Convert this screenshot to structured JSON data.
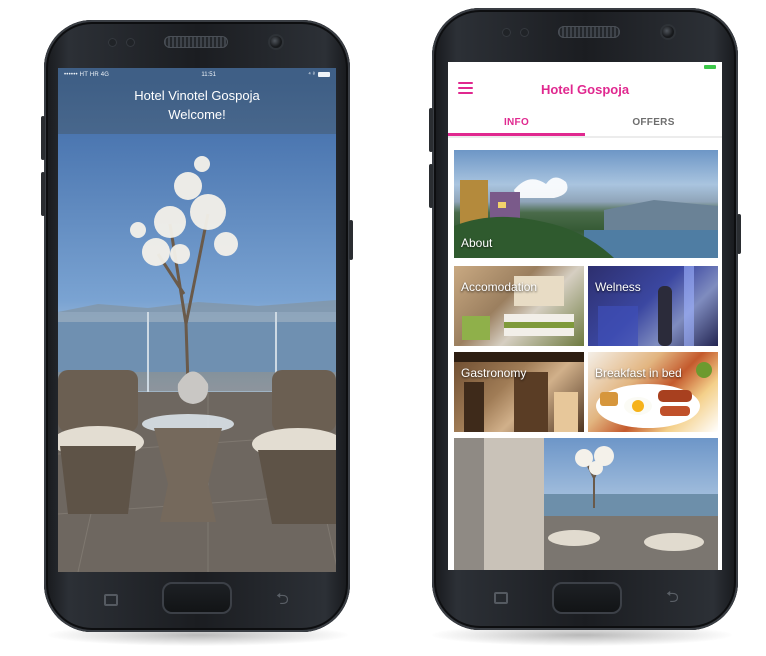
{
  "left_phone": {
    "status_bar": {
      "carrier": "•••••• HT HR  4G",
      "time": "11:51",
      "indicators": "⁴ ⁸"
    },
    "header": {
      "title": "Hotel Vinotel Gospoja",
      "subtitle": "Welcome!"
    },
    "icons": [
      "recent-apps-icon",
      "back-icon"
    ]
  },
  "right_phone": {
    "app_bar": {
      "title": "Hotel Gospoja"
    },
    "tabs": [
      {
        "label": "INFO",
        "active": true
      },
      {
        "label": "OFFERS",
        "active": false
      }
    ],
    "tiles": [
      {
        "label": "About"
      },
      {
        "label": "Accomodation"
      },
      {
        "label": "Welness"
      },
      {
        "label": "Gastronomy"
      },
      {
        "label": "Breakfast in bed"
      },
      {
        "label": ""
      }
    ],
    "icons": [
      "menu-icon",
      "recent-apps-icon",
      "back-icon"
    ]
  },
  "colors": {
    "accent": "#e0288f",
    "left_header": "#3f5f86",
    "battery_green": "#3cc84a"
  }
}
